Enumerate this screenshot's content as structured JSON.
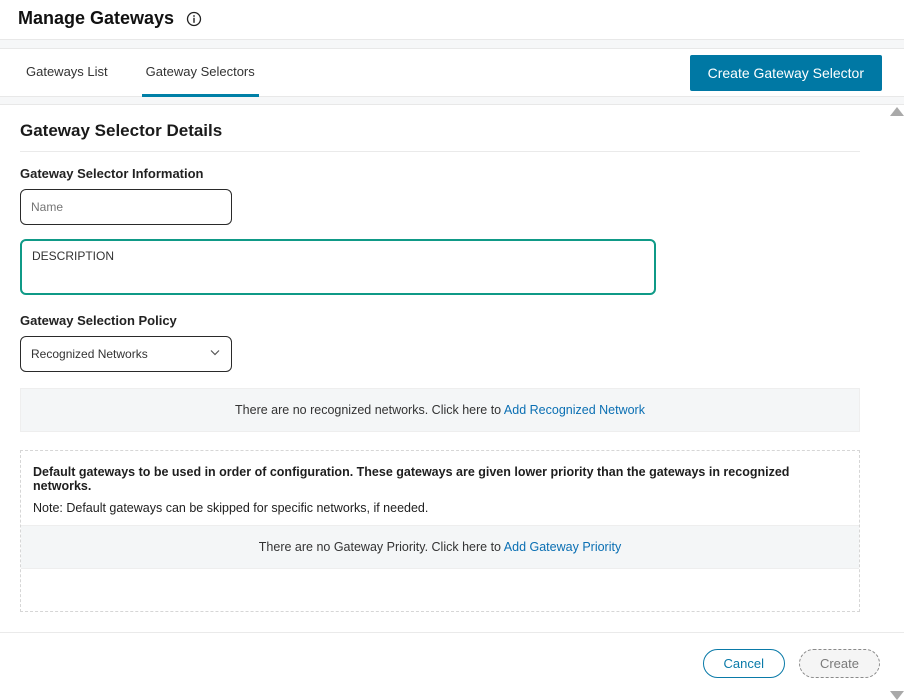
{
  "header": {
    "title": "Manage Gateways"
  },
  "tabs": {
    "gateways_list": "Gateways List",
    "gateway_selectors": "Gateway Selectors"
  },
  "actions": {
    "create_selector": "Create Gateway Selector",
    "cancel": "Cancel",
    "create": "Create"
  },
  "details": {
    "title": "Gateway Selector Details",
    "info_heading": "Gateway Selector Information",
    "name_placeholder": "Name",
    "name_value": "",
    "description_value": "DESCRIPTION",
    "policy_heading": "Gateway Selection Policy",
    "policy_selected": "Recognized Networks",
    "no_networks_text": "There are no recognized networks. Click here to ",
    "add_network_link": "Add Recognized Network",
    "default_gw_title": "Default gateways to be used in order of configuration. These gateways are given lower priority than the gateways in recognized networks.",
    "default_gw_note": "Note: Default gateways can be skipped for specific networks, if needed.",
    "no_priority_text": "There are no Gateway Priority. Click here to ",
    "add_priority_link": "Add Gateway Priority"
  }
}
